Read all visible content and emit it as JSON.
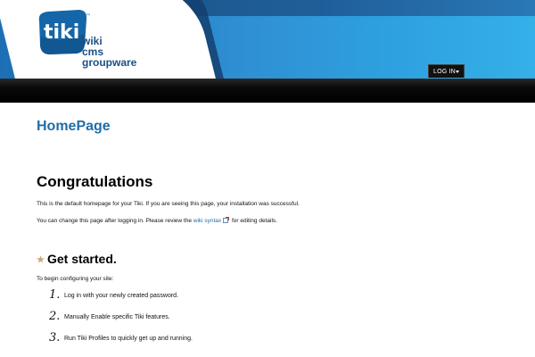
{
  "brand": {
    "logo_word": "tiki",
    "logo_tm": "™",
    "tagline_lines": [
      "wiki",
      "cms",
      "groupware"
    ]
  },
  "header": {
    "login_label": "LOG IN"
  },
  "page": {
    "title": "HomePage",
    "heading": "Congratulations",
    "intro": "This is the default homepage for your Tiki. If you are seeing this page, your installation was successful.",
    "change_before_link": "You can change this page after logging in. Please review the ",
    "change_link": "wiki syntax",
    "change_after_link": " for editing details.",
    "get_started_heading": "Get started.",
    "begin_text": "To begin configuring your site:",
    "steps": [
      {
        "number": "1.",
        "text": "Log in with your newly created password."
      },
      {
        "number": "2.",
        "text": "Manually Enable specific Tiki features."
      },
      {
        "number": "3.",
        "text": "Run Tiki Profiles to quickly get up and running."
      }
    ]
  },
  "colors": {
    "header_blue": "#2f8fd2",
    "title_blue": "#1f6ea8",
    "navbar": "#000000"
  }
}
